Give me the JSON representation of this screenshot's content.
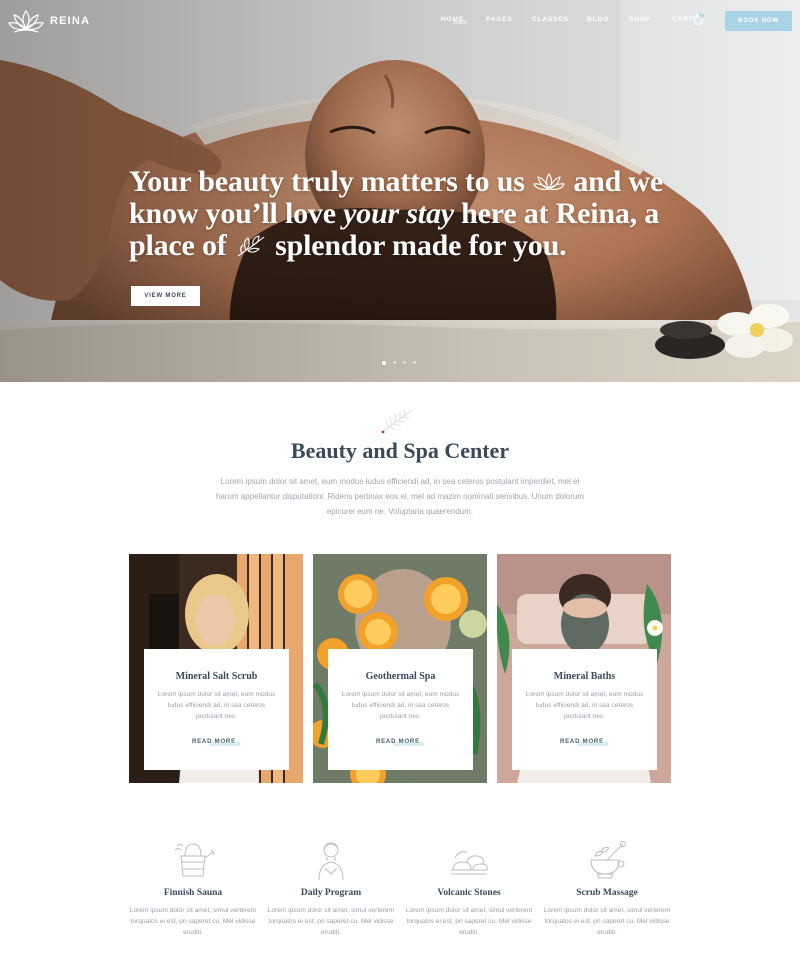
{
  "brand": {
    "name": "REINA"
  },
  "nav": {
    "items": [
      {
        "label": "HOME"
      },
      {
        "label": "PAGES"
      },
      {
        "label": "CLASSES"
      },
      {
        "label": "BLOG"
      },
      {
        "label": "SHOP"
      },
      {
        "label": "CART"
      }
    ],
    "cart_count": "0",
    "book_now": "BOOK NOW"
  },
  "hero": {
    "line1_a": "Your beauty truly matters to us",
    "line1_b": "and we",
    "line2_a": "know you’ll love",
    "line2_em": "your stay",
    "line2_b": "here at Reina, a",
    "line3_a": "place of",
    "line3_b": "splendor made for you.",
    "button": "VIEW MORE",
    "slides": 4,
    "active_slide": 1
  },
  "intro": {
    "title": "Beauty and Spa Center",
    "text": "Lorem ipsum dolor sit amet, eum modus ludus efficiendi ad, in sea ceteros postulant imperdiet, mel ei harum appellantur disputationi. Ridens pertinax eos ei, mel ad mazim nominati sensibus. Unum dolorum epicurei eum ne. Voluptaria quaerendum."
  },
  "cards": [
    {
      "title": "Mineral Salt Scrub",
      "text": "Lorem ipsum dolor sit amet, eum modus ludus efficiendi ad, in sea ceteros postulant nec.",
      "link": "READ MORE"
    },
    {
      "title": "Geothermal Spa",
      "text": "Lorem ipsum dolor sit amet, eum modus ludus efficiendi ad, in sea ceteros postulant nec.",
      "link": "READ MORE"
    },
    {
      "title": "Mineral Baths",
      "text": "Lorem ipsum dolor sit amet, eum modus ludus efficiendi ad, in sea ceteros postulant nec.",
      "link": "READ MORE"
    }
  ],
  "features": [
    {
      "icon": "sauna-bucket-icon",
      "title": "Finnish Sauna",
      "text": "Lorem ipsum dolor sit amet, simul verterem torquatos ei est, pri saperet cu. Mel vidisse eruditi."
    },
    {
      "icon": "woman-silhouette-icon",
      "title": "Daily Program",
      "text": "Lorem ipsum dolor sit amet, simul verterem torquatos ei est, pri saperet cu. Mel vidisse eruditi."
    },
    {
      "icon": "stones-icon",
      "title": "Volcanic Stones",
      "text": "Lorem ipsum dolor sit amet, simul verterem torquatos ei est, pri saperet cu. Mel vidisse eruditi."
    },
    {
      "icon": "mortar-pestle-icon",
      "title": "Scrub Massage",
      "text": "Lorem ipsum dolor sit amet, simul verterem torquatos ei est, pri saperet cu. Mel vidisse eruditi."
    }
  ],
  "colors": {
    "accent": "#a9d4e6",
    "heading": "#3a4a5a",
    "body_text": "#9aa0a8"
  }
}
